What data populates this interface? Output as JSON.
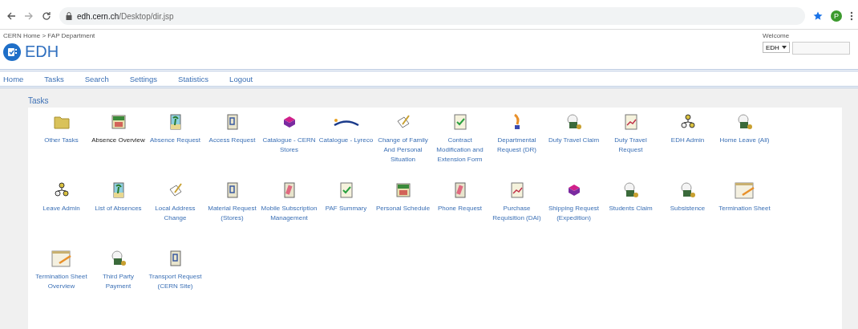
{
  "browser": {
    "url_host": "edh.cern.ch",
    "url_path": "/Desktop/dir.jsp",
    "avatar": "P"
  },
  "header": {
    "breadcrumb": "CERN Home > FAP Department",
    "title": "EDH",
    "welcome": "Welcome",
    "domain_select": "EDH"
  },
  "nav": [
    "Home",
    "Tasks",
    "Search",
    "Settings",
    "Statistics",
    "Logout"
  ],
  "section_title": "Tasks",
  "tasks": [
    {
      "label": "Other Tasks",
      "kind": "folder",
      "visited": false
    },
    {
      "label": "Absence Overview",
      "kind": "calendar",
      "visited": true
    },
    {
      "label": "Absence Request",
      "kind": "palm",
      "visited": false
    },
    {
      "label": "Access Request",
      "kind": "door",
      "visited": false
    },
    {
      "label": "Catalogue - CERN Stores",
      "kind": "books",
      "visited": false
    },
    {
      "label": "Catalogue - Lyreco",
      "kind": "lyreco",
      "visited": false
    },
    {
      "label": "Change of Family And Personal Situation",
      "kind": "pen",
      "visited": false
    },
    {
      "label": "Contract Modification and Extension Form",
      "kind": "check",
      "visited": false
    },
    {
      "label": "Departmental Request (DR)",
      "kind": "quill",
      "visited": false
    },
    {
      "label": "Duty Travel Claim",
      "kind": "money",
      "visited": false
    },
    {
      "label": "Duty Travel Request",
      "kind": "chart",
      "visited": false
    },
    {
      "label": "EDH Admin",
      "kind": "people",
      "visited": false
    },
    {
      "label": "Home Leave (All)",
      "kind": "money",
      "visited": false
    },
    {
      "label": "Leave Admin",
      "kind": "people",
      "visited": false
    },
    {
      "label": "List of Absences",
      "kind": "palm",
      "visited": false
    },
    {
      "label": "Local Address Change",
      "kind": "pen",
      "visited": false
    },
    {
      "label": "Material Request (Stores)",
      "kind": "door",
      "visited": false
    },
    {
      "label": "Mobile Subscription Management",
      "kind": "phone",
      "visited": false
    },
    {
      "label": "PAF Summary",
      "kind": "check",
      "visited": false
    },
    {
      "label": "Personal Schedule",
      "kind": "calendar",
      "visited": false
    },
    {
      "label": "Phone Request",
      "kind": "phone",
      "visited": false
    },
    {
      "label": "Purchase Requisition (DAI)",
      "kind": "chart",
      "visited": false
    },
    {
      "label": "Shipping Request (Expedition)",
      "kind": "books",
      "visited": false
    },
    {
      "label": "Students Claim",
      "kind": "money",
      "visited": false
    },
    {
      "label": "Subsistence",
      "kind": "money",
      "visited": false
    },
    {
      "label": "Termination Sheet",
      "kind": "notepad",
      "visited": false
    },
    {
      "label": "Termination Sheet Overview",
      "kind": "notepad",
      "visited": false
    },
    {
      "label": "Third Party Payment",
      "kind": "money",
      "visited": false
    },
    {
      "label": "Transport Request (CERN Site)",
      "kind": "door",
      "visited": false
    }
  ]
}
